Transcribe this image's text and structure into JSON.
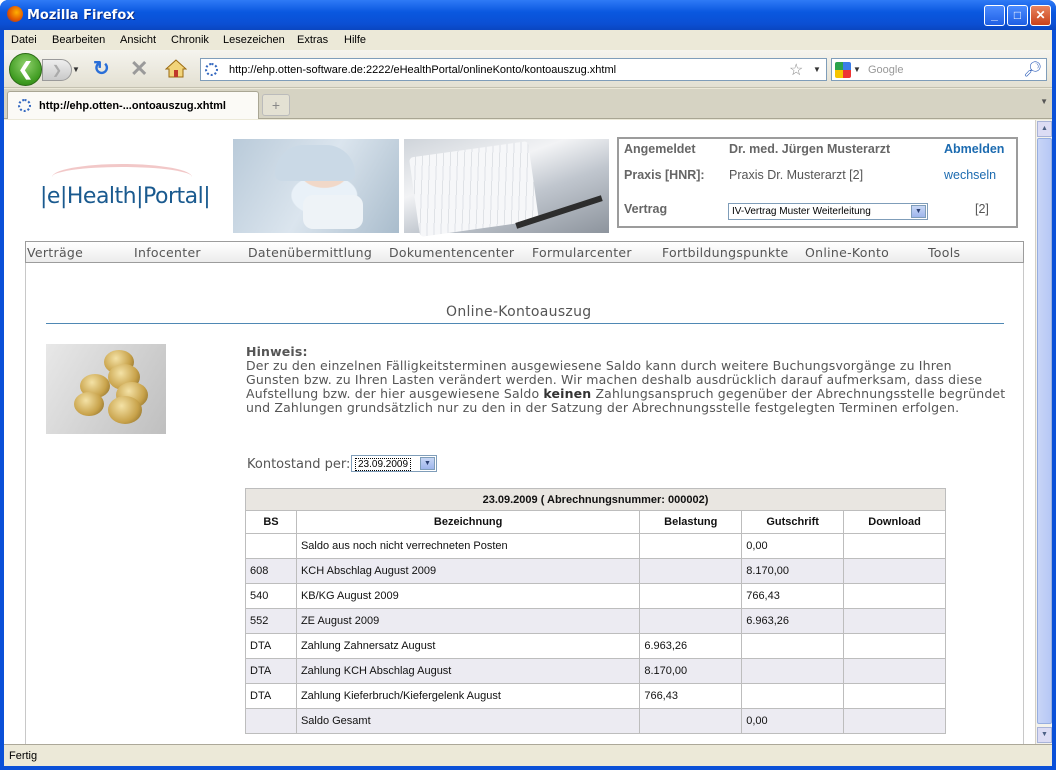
{
  "window": {
    "title": "Mozilla Firefox"
  },
  "menu": [
    "Datei",
    "Bearbeiten",
    "Ansicht",
    "Chronik",
    "Lesezeichen",
    "Extras",
    "Hilfe"
  ],
  "navbar": {
    "url": "http://ehp.otten-software.de:2222/eHealthPortal/onlineKonto/kontoauszug.xhtml",
    "search_placeholder": "Google"
  },
  "tab": {
    "label": "http://ehp.otten-...ontoauszug.xhtml"
  },
  "logo": {
    "part1": "|e|Health|",
    "part2": "Portal",
    "part3": "|"
  },
  "login": {
    "angemeldet_label": "Angemeldet",
    "user": "Dr. med. Jürgen Musterarzt",
    "logout": "Abmelden",
    "praxis_label": "Praxis [HNR]:",
    "praxis": "Praxis Dr. Musterarzt [2]",
    "change": "wechseln",
    "vertrag_label": "Vertrag",
    "vertrag_value": "IV-Vertrag Muster Weiterleitung",
    "vertrag_num": "[2]"
  },
  "mainnav": [
    "Verträge",
    "Infocenter",
    "Datenübermittlung",
    "Dokumentencenter",
    "Formularcenter",
    "Fortbildungspunkte",
    "Online-Konto",
    "Tools"
  ],
  "page": {
    "title": "Online-Kontoauszug",
    "notice_heading": "Hinweis:",
    "notice_part1": "Der zu den einzelnen Fälligkeitsterminen ausgewiesene Saldo kann durch weitere Buchungsvorgänge zu Ihren Gunsten bzw. zu Ihren Lasten verändert werden. Wir machen deshalb ausdrücklich darauf aufmerksam, dass diese Aufstellung bzw. der hier ausgewiesene Saldo ",
    "notice_bold": "keinen",
    "notice_part2": " Zahlungsanspruch gegenüber der Abrechnungsstelle begründet und Zahlungen grundsätzlich nur zu den in der Satzung der Abrechnungsstelle festgelegten Terminen erfolgen.",
    "kontostand_label": "Kontostand per:",
    "kontostand_date": "23.09.2009"
  },
  "table": {
    "caption": "23.09.2009 ( Abrechnungsnummer: 000002)",
    "headers": [
      "BS",
      "Bezeichnung",
      "Belastung",
      "Gutschrift",
      "Download"
    ],
    "rows": [
      [
        "",
        "Saldo aus noch nicht verrechneten Posten",
        "",
        "0,00",
        ""
      ],
      [
        "608",
        "KCH Abschlag August 2009",
        "",
        "8.170,00",
        ""
      ],
      [
        "540",
        "KB/KG August 2009",
        "",
        "766,43",
        ""
      ],
      [
        "552",
        "ZE August 2009",
        "",
        "6.963,26",
        ""
      ],
      [
        "DTA",
        "Zahlung Zahnersatz August",
        "6.963,26",
        "",
        ""
      ],
      [
        "DTA",
        "Zahlung KCH Abschlag August",
        "8.170,00",
        "",
        ""
      ],
      [
        "DTA",
        "Zahlung Kieferbruch/Kiefergelenk August",
        "766,43",
        "",
        ""
      ],
      [
        "",
        "Saldo Gesamt",
        "",
        "0,00",
        ""
      ]
    ]
  },
  "status": "Fertig"
}
